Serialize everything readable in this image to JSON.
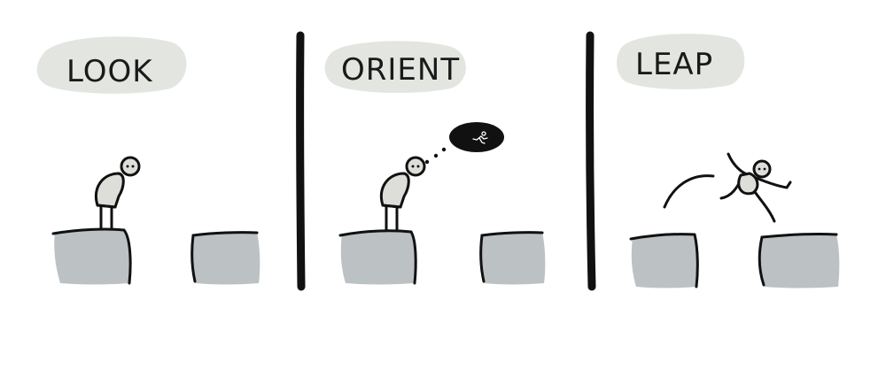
{
  "panels": [
    {
      "title": "LOOK"
    },
    {
      "title": "ORIENT"
    },
    {
      "title": "LEAP"
    }
  ],
  "colors": {
    "label_bubble": "#e3e5e1",
    "block_fill": "#bcc1c4",
    "ink": "#111111",
    "figure_fill": "#ddded9"
  }
}
